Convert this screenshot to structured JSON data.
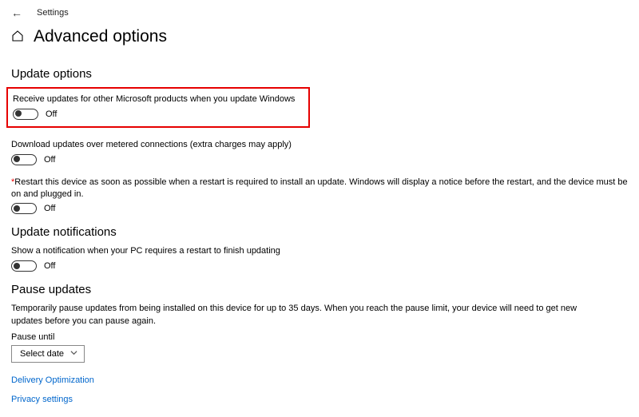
{
  "app_name": "Settings",
  "page_title": "Advanced options",
  "sections": {
    "update_options": {
      "heading": "Update options",
      "opts": [
        {
          "label": "Receive updates for other Microsoft products when you update Windows",
          "state": "Off",
          "highlighted": true
        },
        {
          "label": "Download updates over metered connections (extra charges may apply)",
          "state": "Off"
        },
        {
          "label": "Restart this device as soon as possible when a restart is required to install an update. Windows will display a notice before the restart, and the device must be on and plugged in.",
          "state": "Off",
          "asterisk": true
        }
      ]
    },
    "update_notifications": {
      "heading": "Update notifications",
      "opts": [
        {
          "label": "Show a notification when your PC requires a restart to finish updating",
          "state": "Off"
        }
      ]
    },
    "pause_updates": {
      "heading": "Pause updates",
      "desc": "Temporarily pause updates from being installed on this device for up to 35 days. When you reach the pause limit, your device will need to get new updates before you can pause again.",
      "field_label": "Pause until",
      "select_value": "Select date"
    }
  },
  "links": {
    "delivery": "Delivery Optimization",
    "privacy": "Privacy settings"
  }
}
